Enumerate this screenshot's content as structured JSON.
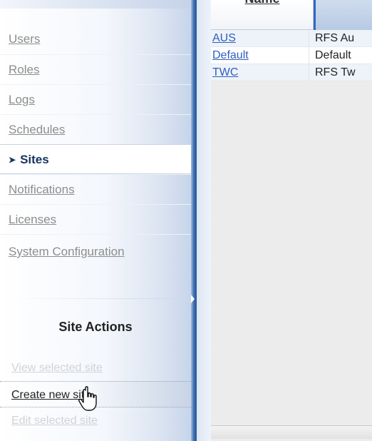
{
  "sidebar": {
    "nav_items": [
      {
        "label": "Users"
      },
      {
        "label": "Roles"
      },
      {
        "label": "Logs"
      },
      {
        "label": "Schedules"
      },
      {
        "label": "Sites",
        "active": true
      },
      {
        "label": "Notifications"
      },
      {
        "label": "Licenses"
      },
      {
        "label": "System Configuration"
      }
    ],
    "actions_title": "Site Actions",
    "actions": [
      {
        "label": "View selected site",
        "enabled": false
      },
      {
        "label": "Create new site",
        "enabled": true
      },
      {
        "label": "Edit selected site",
        "enabled": false
      }
    ]
  },
  "grid": {
    "column_header": "Name",
    "rows": [
      {
        "id": "AUS",
        "name": "RFS Au"
      },
      {
        "id": "Default",
        "name": "Default"
      },
      {
        "id": "TWC",
        "name": "RFS Tw"
      }
    ]
  },
  "colors": {
    "accent_blue": "#2d67c4",
    "link_blue": "#2f5fbf",
    "active_text": "#15335d"
  },
  "icons": {
    "active_indicator": "arrow-right-icon",
    "cursor": "hand-pointer-cursor-icon"
  }
}
